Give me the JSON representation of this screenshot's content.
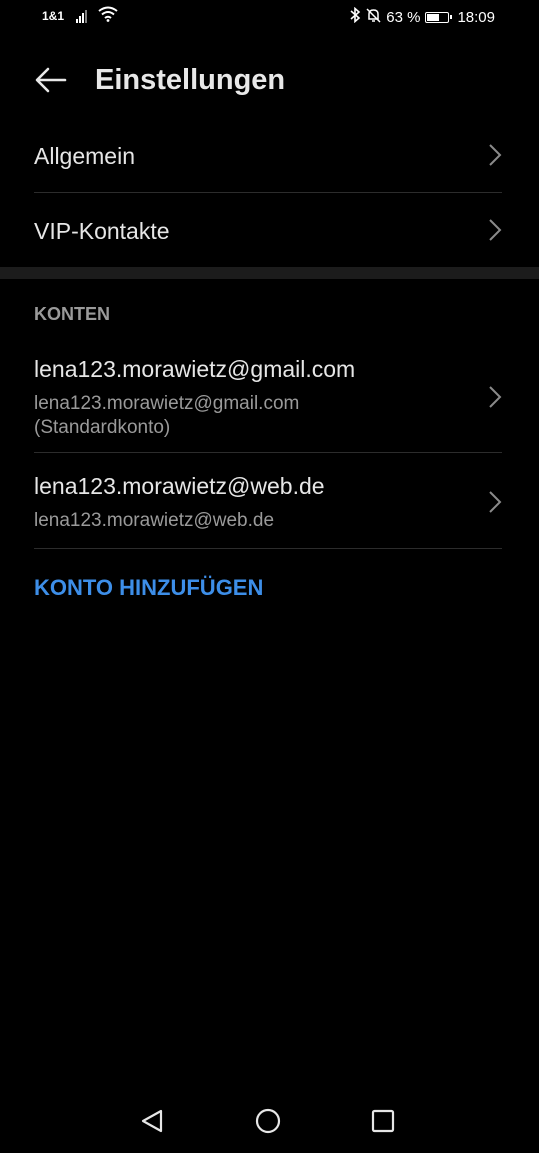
{
  "status_bar": {
    "carrier": "1&1",
    "battery_percent": "63 %",
    "battery_level": 0.63,
    "time": "18:09",
    "icons": [
      "signal-icon",
      "wifi-icon",
      "bluetooth-icon",
      "mute-icon",
      "battery-icon"
    ]
  },
  "header": {
    "title": "Einstellungen",
    "back_icon": "back-arrow-icon"
  },
  "general_items": [
    {
      "label": "Allgemein"
    },
    {
      "label": "VIP-Kontakte"
    }
  ],
  "accounts_section": {
    "header": "KONTEN",
    "accounts": [
      {
        "email": "lena123.morawietz@gmail.com",
        "subtitle_line1": "lena123.morawietz@gmail.com",
        "subtitle_line2": "(Standardkonto)"
      },
      {
        "email": "lena123.morawietz@web.de",
        "subtitle_line1": "lena123.morawietz@web.de"
      }
    ],
    "add_account_label": "KONTO HINZUFÜGEN"
  },
  "nav_bar": {
    "buttons": [
      "back-triangle-icon",
      "home-circle-icon",
      "recents-square-icon"
    ]
  },
  "colors": {
    "background": "#000000",
    "accent": "#3d8ee8",
    "primary_text": "#e6e6e6",
    "secondary_text": "#9a9a9a"
  }
}
